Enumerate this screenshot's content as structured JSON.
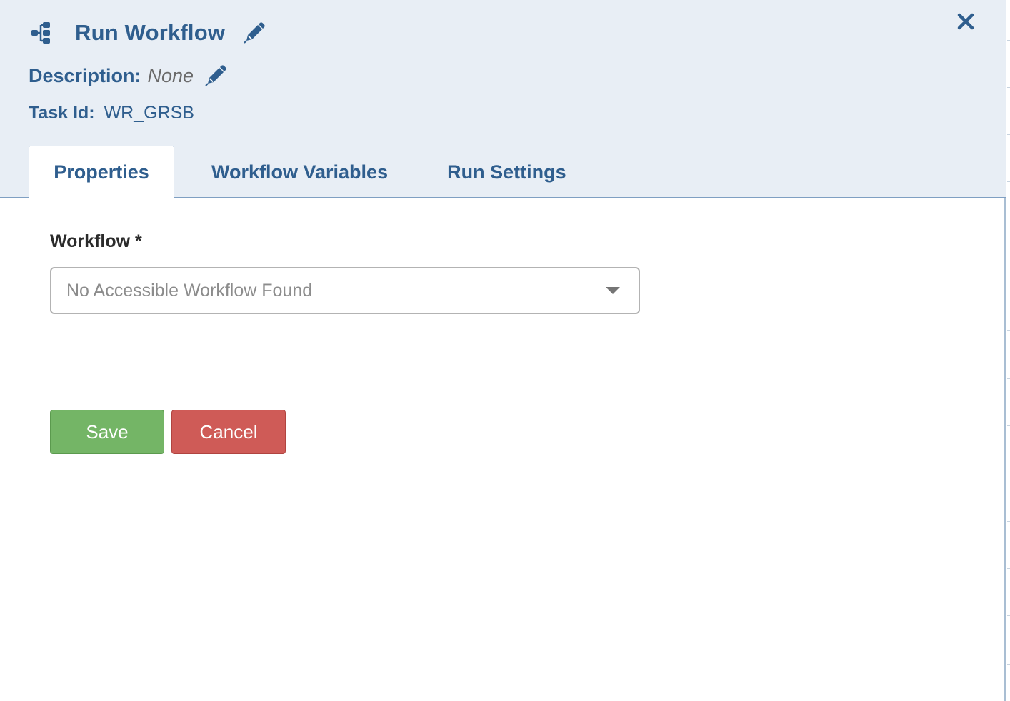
{
  "header": {
    "title": "Run Workflow",
    "description_label": "Description:",
    "description_value": "None",
    "task_id_label": "Task Id:",
    "task_id_value": "WR_GRSB"
  },
  "tabs": [
    {
      "label": "Properties",
      "active": true
    },
    {
      "label": "Workflow Variables",
      "active": false
    },
    {
      "label": "Run Settings",
      "active": false
    }
  ],
  "form": {
    "workflow_label": "Workflow *",
    "workflow_selected": "No Accessible Workflow Found"
  },
  "buttons": {
    "save_label": "Save",
    "cancel_label": "Cancel"
  },
  "icons": {
    "header_icon": "workflow-tree-icon",
    "edit": "pencil-icon",
    "close": "close-icon",
    "dropdown": "caret-down-icon"
  },
  "colors": {
    "header_bg": "#e8eef5",
    "primary_text": "#2f5e8e",
    "save": "#74b566",
    "cancel": "#cf5b57"
  }
}
